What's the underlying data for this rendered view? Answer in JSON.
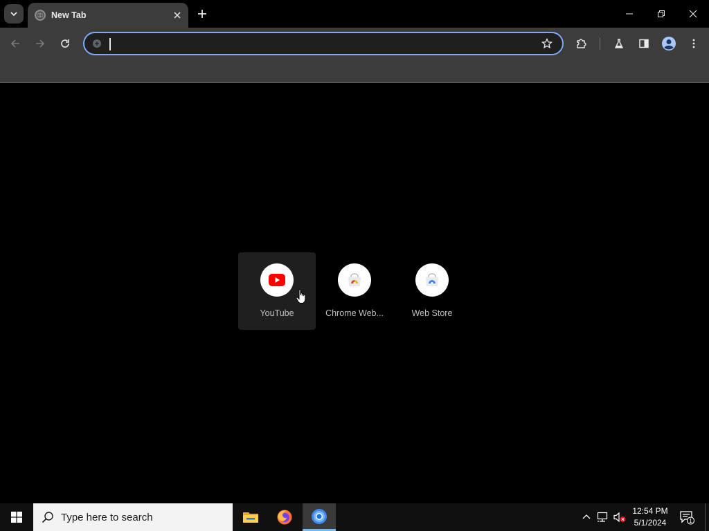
{
  "browser": {
    "tabs": [
      {
        "title": "New Tab",
        "favicon": "globe-icon",
        "active": true
      }
    ],
    "omnibox": {
      "value": "",
      "placeholder": ""
    },
    "colors": {
      "accent": "#7cacf8",
      "toolbar": "#3c3c3c",
      "tab_strip": "#000000"
    }
  },
  "shortcuts": [
    {
      "label": "YouTube",
      "icon": "youtube-icon"
    },
    {
      "label": "Chrome Web...",
      "icon": "chrome-web-store-icon"
    },
    {
      "label": "Web Store",
      "icon": "web-store-icon"
    }
  ],
  "taskbar": {
    "search_placeholder": "Type here to search",
    "apps": [
      "file-explorer-icon",
      "firefox-icon",
      "chrome-icon"
    ],
    "clock": {
      "time": "12:54 PM",
      "date": "5/1/2024"
    },
    "notification_count": "1"
  }
}
